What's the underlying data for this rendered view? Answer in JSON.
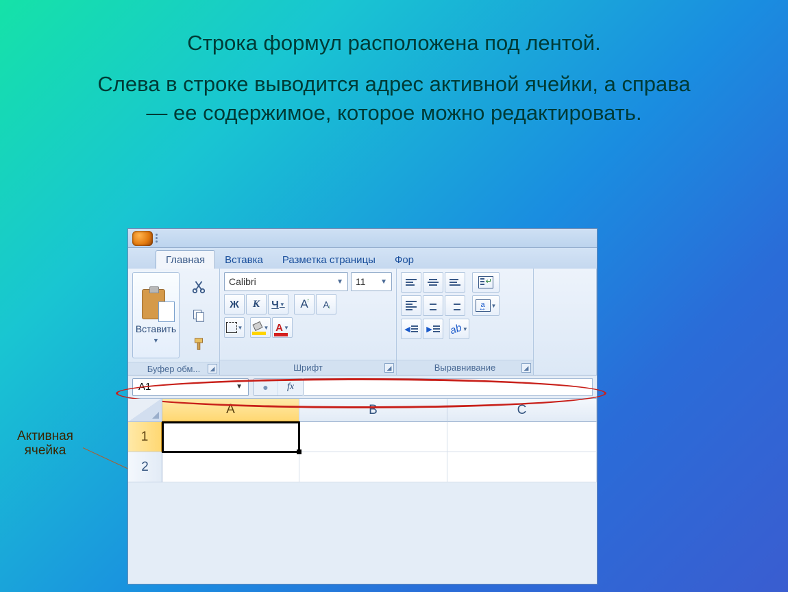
{
  "slide": {
    "title": "Строка формул расположена под лентой.",
    "body": "Слева в строке выводится адрес активной ячейки, а справа — ее содержимое, которое можно редактировать.",
    "annotation_line1": "Активная",
    "annotation_line2": "ячейка"
  },
  "excel": {
    "tabs": {
      "home": "Главная",
      "insert": "Вставка",
      "layout": "Разметка страницы",
      "formulas": "Фор"
    },
    "clipboard": {
      "paste": "Вставить",
      "group": "Буфер обм..."
    },
    "font": {
      "name": "Calibri",
      "size": "11",
      "bold": "Ж",
      "italic": "К",
      "underline": "Ч",
      "group": "Шрифт",
      "color_letter": "А"
    },
    "alignment": {
      "group": "Выравнивание"
    },
    "formula_bar": {
      "namebox": "A1",
      "fx": "fx"
    },
    "columns": {
      "A": "A",
      "B": "B",
      "C": "C"
    },
    "rows": {
      "r1": "1",
      "r2": "2"
    }
  }
}
